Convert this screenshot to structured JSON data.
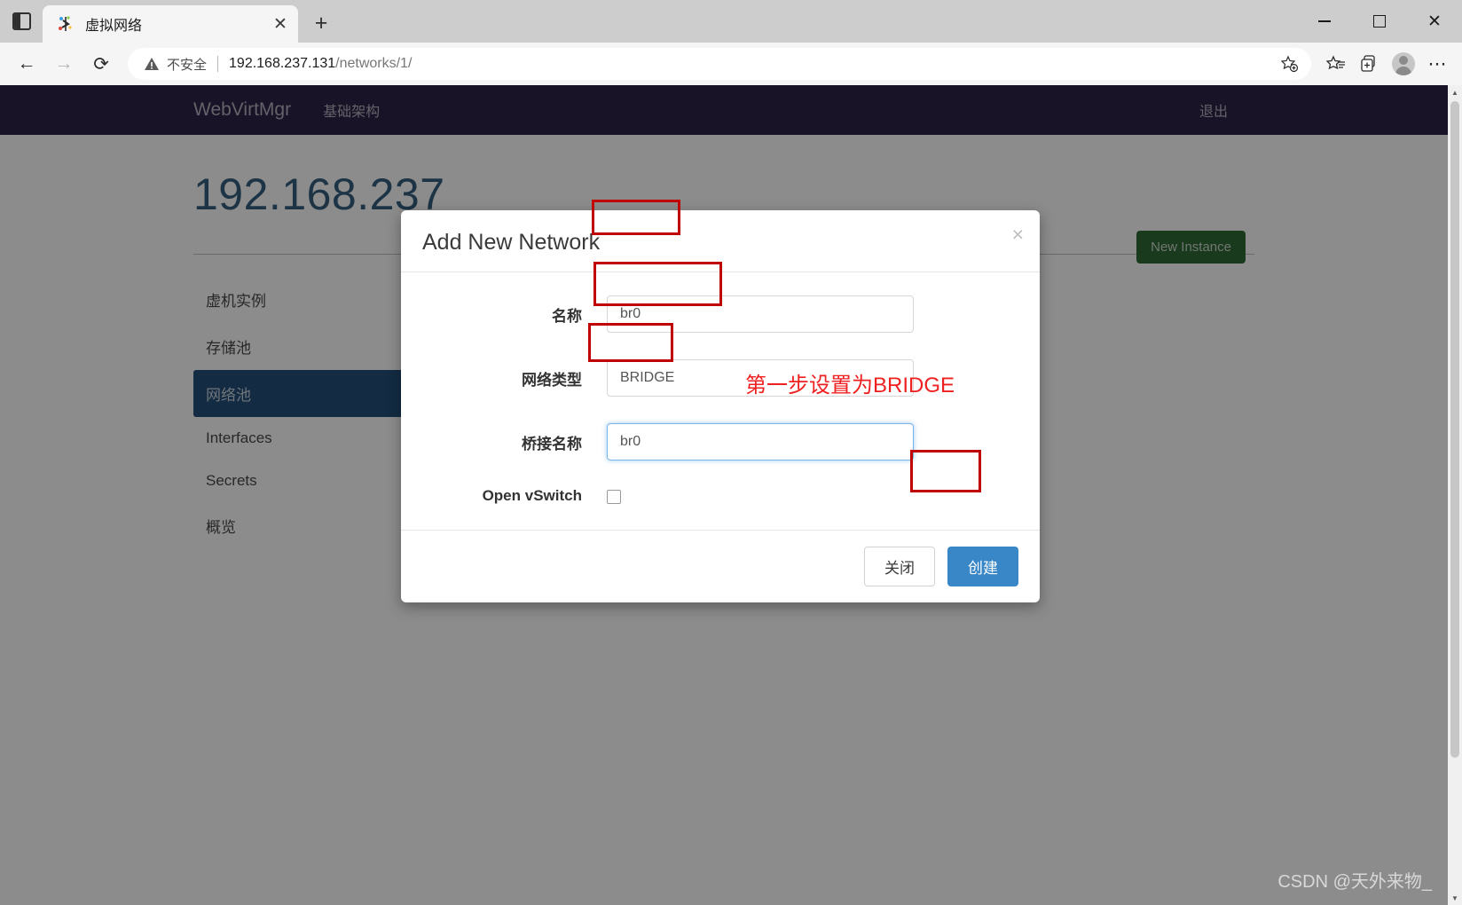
{
  "browser": {
    "tab": {
      "title": "虚拟网络",
      "favicon_name": "webvirtmgr-favicon",
      "close_label": "✕"
    },
    "new_tab_label": "+",
    "tab_strip_label": "tab-actions",
    "window_controls": {
      "minimize": "—",
      "maximize": "□",
      "close": "✕"
    },
    "toolbar": {
      "back": "←",
      "forward": "→",
      "reload": "⟳",
      "security_text": "不安全",
      "url_host": "192.168.237.131",
      "url_path": "/networks/1/",
      "add_favorite": "☆",
      "favorites": "☆",
      "collections": "⊞",
      "profile": "profile",
      "settings": "⋯"
    }
  },
  "navbar": {
    "brand": "WebVirtMgr",
    "links": [
      "基础架构"
    ],
    "logout": "退出"
  },
  "page": {
    "title": "192.168.237",
    "new_instance_label": "New Instance",
    "sidebar": [
      {
        "label": "虚机实例",
        "active": false
      },
      {
        "label": "存储池",
        "active": false
      },
      {
        "label": "网络池",
        "active": true
      },
      {
        "label": "Interfaces",
        "active": false
      },
      {
        "label": "Secrets",
        "active": false
      },
      {
        "label": "概览",
        "active": false
      }
    ]
  },
  "modal": {
    "title": "Add New Network",
    "close_label": "×",
    "fields": [
      {
        "label": "名称",
        "value": "br0",
        "placeholder": "",
        "focused": false
      },
      {
        "label": "网络类型",
        "value": "BRIDGE",
        "placeholder": "",
        "focused": false
      },
      {
        "label": "桥接名称",
        "value": "br0",
        "placeholder": "",
        "focused": true
      }
    ],
    "checkbox_label": "Open vSwitch",
    "checkbox_checked": false,
    "buttons": {
      "close": "关闭",
      "create": "创建"
    }
  },
  "annotations": {
    "bridge_note": "第一步设置为BRIDGE",
    "color": "#ef2020"
  },
  "watermark": "CSDN @天外来物_",
  "colors": {
    "navbar_bg": "#2e2347",
    "title_blue": "#34607f",
    "sidebar_active": "#24517a",
    "new_instance_green": "#2e6b35",
    "primary_blue": "#3a87c8",
    "annotation_red": "#c00000"
  }
}
